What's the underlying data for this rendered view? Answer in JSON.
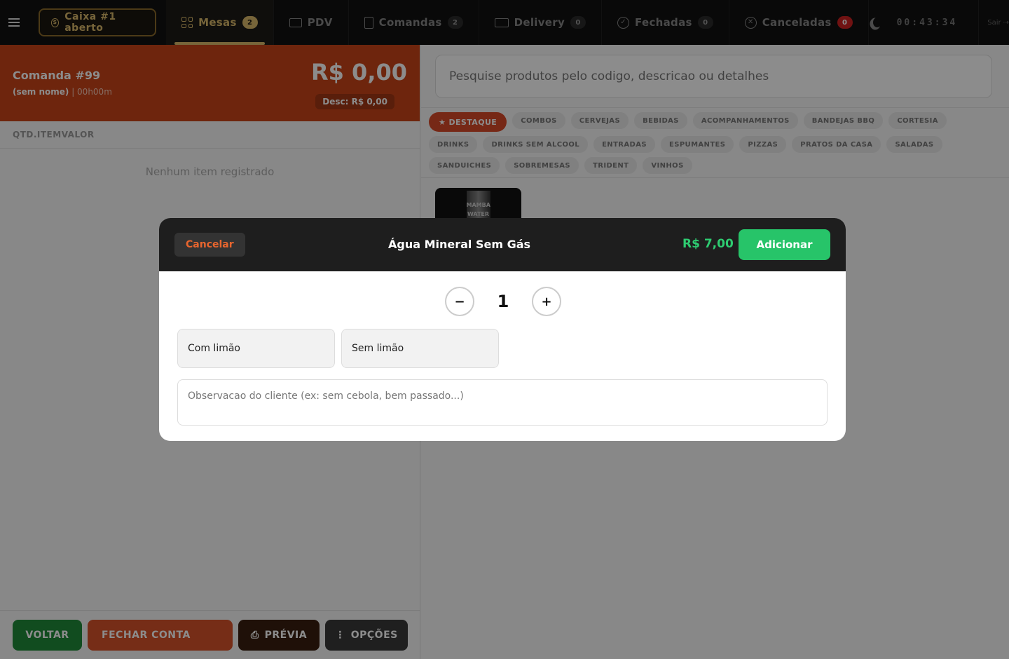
{
  "nav": {
    "caixa": "Caixa #1 aberto",
    "tabs": [
      {
        "label": "Mesas",
        "badge": "2"
      },
      {
        "label": "PDV",
        "badge": ""
      },
      {
        "label": "Comandas",
        "badge": "2"
      },
      {
        "label": "Delivery",
        "badge": "0"
      },
      {
        "label": "Fechadas",
        "badge": "0"
      },
      {
        "label": "Canceladas",
        "badge": "0"
      }
    ],
    "clock": "00:43:34",
    "logout": "Sair"
  },
  "comanda": {
    "title": "Comanda #99",
    "name": "(sem nome)",
    "duration": "00h00m",
    "total": "R$ 0,00",
    "discount_label": "Desc:",
    "discount_value": "R$ 0,00",
    "items_header": "QTD.ITEMVALOR",
    "empty_message": "Nenhum item registrado"
  },
  "actions": {
    "voltar": "VOLTAR",
    "fechar": "FECHAR CONTA",
    "previa": "PRÉVIA",
    "opcoes": "OPÇÕES"
  },
  "catalog": {
    "search_placeholder": "Pesquise produtos pelo codigo, descricao ou detalhes",
    "categories": [
      "★ DESTAQUE",
      "COMBOS",
      "CERVEJAS",
      "BEBIDAS",
      "ACOMPANHAMENTOS",
      "BANDEJAS BBQ",
      "CORTESIA",
      "DRINKS",
      "DRINKS SEM ALCOOL",
      "ENTRADAS",
      "ESPUMANTES",
      "PIZZAS",
      "PRATOS DA CASA",
      "SALADAS",
      "SANDUICHES",
      "SOBREMESAS",
      "TRIDENT",
      "VINHOS"
    ],
    "product_image_text": "MAMBA WATER"
  },
  "modal": {
    "cancel": "Cancelar",
    "title": "Água Mineral Sem Gás",
    "price": "R$ 7,00",
    "add": "Adicionar",
    "quantity": "1",
    "options": [
      "Com limão",
      "Sem limão"
    ],
    "note_placeholder": "Observacao do cliente (ex: sem cebola, bem passado...)"
  }
}
